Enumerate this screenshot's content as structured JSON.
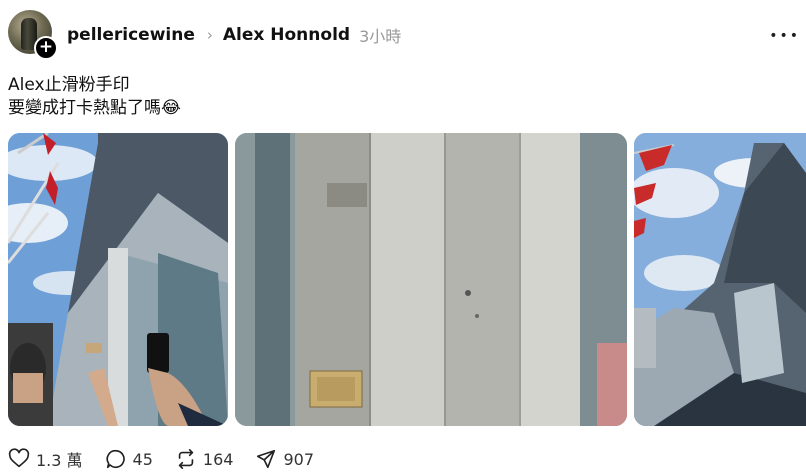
{
  "post": {
    "username": "pellericewine",
    "topic": "Alex Honnold",
    "time": "3小時",
    "caption_line1": "Alex止滑粉手印",
    "caption_line2": "要變成打卡熱點了嗎",
    "emoji": "😂"
  },
  "actions": {
    "likes": "1.3 萬",
    "comments": "45",
    "reposts": "164",
    "shares": "907"
  },
  "icons": {
    "menu": "more-icon",
    "like": "heart-icon",
    "comment": "comment-icon",
    "repost": "repost-icon",
    "share": "send-icon"
  },
  "colors": {
    "text": "#111111",
    "muted": "#999999",
    "background": "#ffffff"
  }
}
